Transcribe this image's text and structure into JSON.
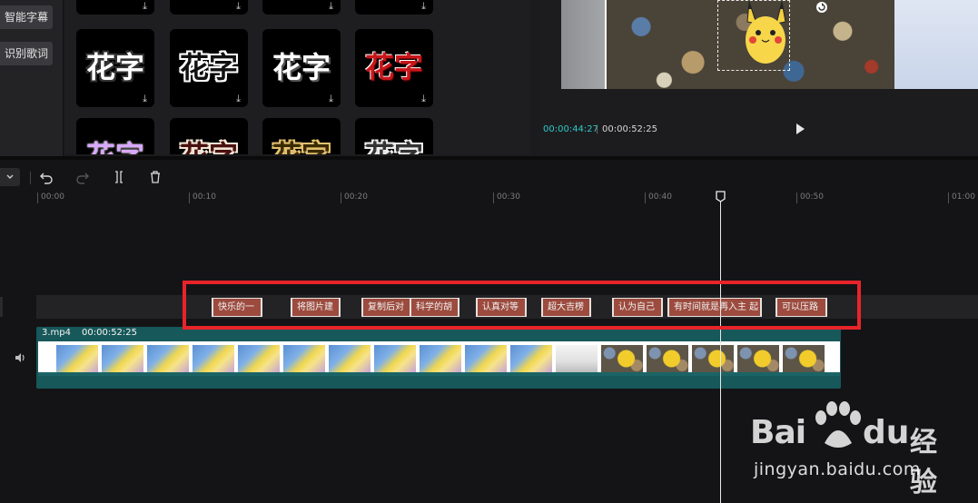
{
  "sidebar": {
    "buttons": [
      "智能字幕",
      "识别歌词"
    ]
  },
  "effects": {
    "tiles_row1": [
      {
        "text": "花字",
        "style": "s-white-outline"
      },
      {
        "text": "花字",
        "style": "s-black-outline"
      },
      {
        "text": "花字",
        "style": "s-white"
      },
      {
        "text": "花字",
        "style": "s-red"
      }
    ],
    "tiles_row2": [
      {
        "text": "花字",
        "style": "s-purple"
      },
      {
        "text": "花字",
        "style": "s-darkred"
      },
      {
        "text": "花字",
        "style": "s-gold"
      },
      {
        "text": "花字",
        "style": "s-gray"
      }
    ],
    "download_icon": "download-icon"
  },
  "player": {
    "current_time": "00:00:44:27",
    "separator": "|",
    "total_time": "00:00:52:25",
    "accent_color": "#2fc8c8"
  },
  "ruler": {
    "ticks": [
      "00:00",
      "00:10",
      "00:20",
      "00:30",
      "00:40",
      "00:50",
      "01:00"
    ]
  },
  "text_clips": [
    "快乐的一",
    "将图片建",
    "复制后对",
    "科学的胡",
    "认真对等",
    "超大吉楞",
    "认为自己",
    "有时间就是再入主 起",
    "可以压路"
  ],
  "video_clip": {
    "name": "3.mp4",
    "duration": "00:00:52:25",
    "color": "#17585a"
  },
  "highlight_color": "#e8242a",
  "watermark": {
    "brand_left": "Bai",
    "brand_du": "du",
    "brand_cn": "经验",
    "url": "jingyan.baidu.com"
  }
}
